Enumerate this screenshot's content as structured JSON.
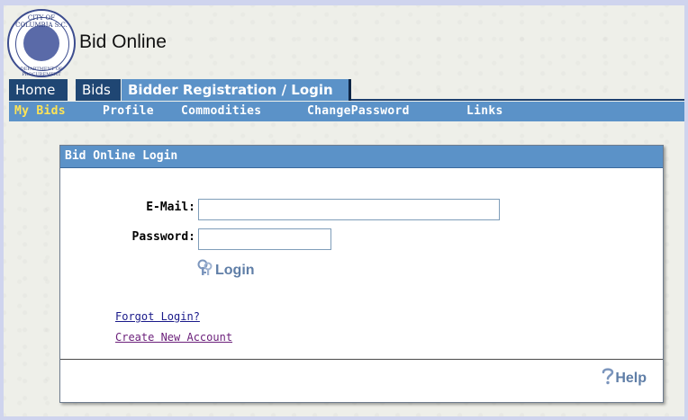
{
  "brand": {
    "title": "Bid Online",
    "seal_top_text": "CITY OF COLUMBIA S.C.",
    "seal_bottom_text": "DEPARTMENT OF PROCUREMENT"
  },
  "tabs": [
    {
      "label": "Home"
    },
    {
      "label": "Bids"
    },
    {
      "label": "Bidder Registration / Login",
      "active": true
    }
  ],
  "subnav": [
    {
      "label": "My Bids",
      "active": true
    },
    {
      "label": "Profile"
    },
    {
      "label": "Commodities"
    },
    {
      "label": "ChangePassword"
    },
    {
      "label": "Links"
    }
  ],
  "login_panel": {
    "title": "Bid Online Login",
    "email_label": "E-Mail:",
    "email_value": "",
    "password_label": "Password:",
    "password_value": "",
    "login_button": "Login",
    "forgot_link": "Forgot Login?",
    "create_link": "Create New Account",
    "help_button": "Help"
  },
  "colors": {
    "nav_dark": "#1f4673",
    "nav_light": "#5b92c8",
    "subnav_active": "#ffe455",
    "button_text": "#5f7ea7"
  },
  "icons": {
    "login": "keys-icon",
    "help": "question-mark-icon"
  }
}
